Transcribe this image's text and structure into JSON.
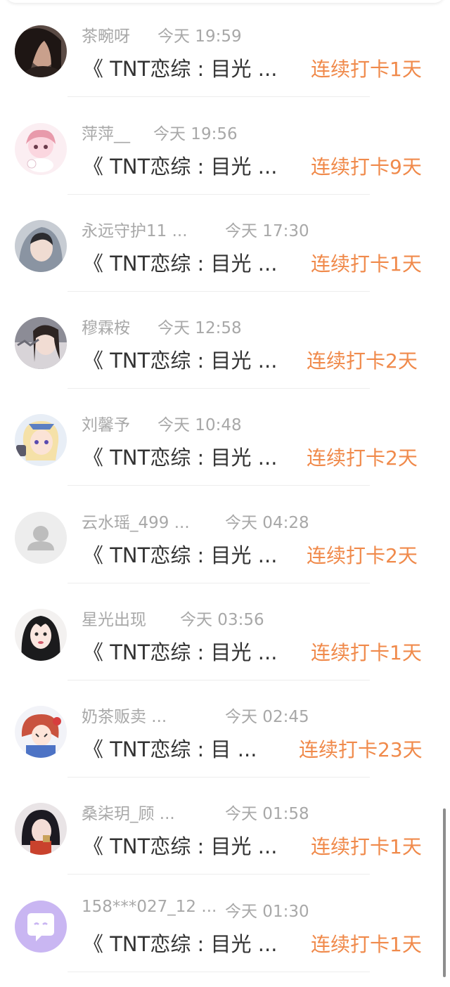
{
  "colors": {
    "name_text": "#a8a8a8",
    "message_text": "#333333",
    "streak_text": "#f08a4b",
    "divider": "#ededed"
  },
  "items": [
    {
      "name": "茶畹呀",
      "time": "今天 19:59",
      "message": "《 TNT恋综 : 目光 ...",
      "streak": "连续打卡1天",
      "avatar": "user-avatar-photo"
    },
    {
      "name": "萍萍__",
      "time": "今天 19:56",
      "message": "《 TNT恋综 : 目光 ...",
      "streak": "连续打卡9天",
      "avatar": "user-avatar-anime-pink"
    },
    {
      "name": "永远守护11 ...",
      "time": "今天 17:30",
      "message": "《 TNT恋综 : 目光 ...",
      "streak": "连续打卡1天",
      "avatar": "user-avatar-photo-hood"
    },
    {
      "name": "穆霖桉",
      "time": "今天 12:58",
      "message": "《 TNT恋综 : 目光 ...",
      "streak": "连续打卡2天",
      "avatar": "user-avatar-photo"
    },
    {
      "name": "刘馨予",
      "time": "今天 10:48",
      "message": "《 TNT恋综 : 目光 ...",
      "streak": "连续打卡2天",
      "avatar": "user-avatar-anime-blonde"
    },
    {
      "name": "云水瑶_499 ...",
      "time": "今天 04:28",
      "message": "《 TNT恋综 : 目光 ...",
      "streak": "连续打卡2天",
      "avatar": "default-user-icon"
    },
    {
      "name": "星光出现",
      "time": "今天 03:56",
      "message": "《 TNT恋综 : 目光 ...",
      "streak": "连续打卡1天",
      "avatar": "user-avatar-illustration"
    },
    {
      "name": "奶茶贩卖 ...",
      "time": "今天 02:45",
      "message": "《 TNT恋综 : 目 ...",
      "streak": "连续打卡23天",
      "avatar": "user-avatar-anime-red"
    },
    {
      "name": "桑柒玥_顾 ...",
      "time": "今天 01:58",
      "message": "《 TNT恋综 : 目光 ...",
      "streak": "连续打卡1天",
      "avatar": "user-avatar-photo"
    },
    {
      "name": "158***027_12 ...",
      "time": "今天 01:30",
      "message": "《 TNT恋综 : 目光 ...",
      "streak": "连续打卡1天",
      "avatar": "chat-bubble-icon"
    }
  ]
}
